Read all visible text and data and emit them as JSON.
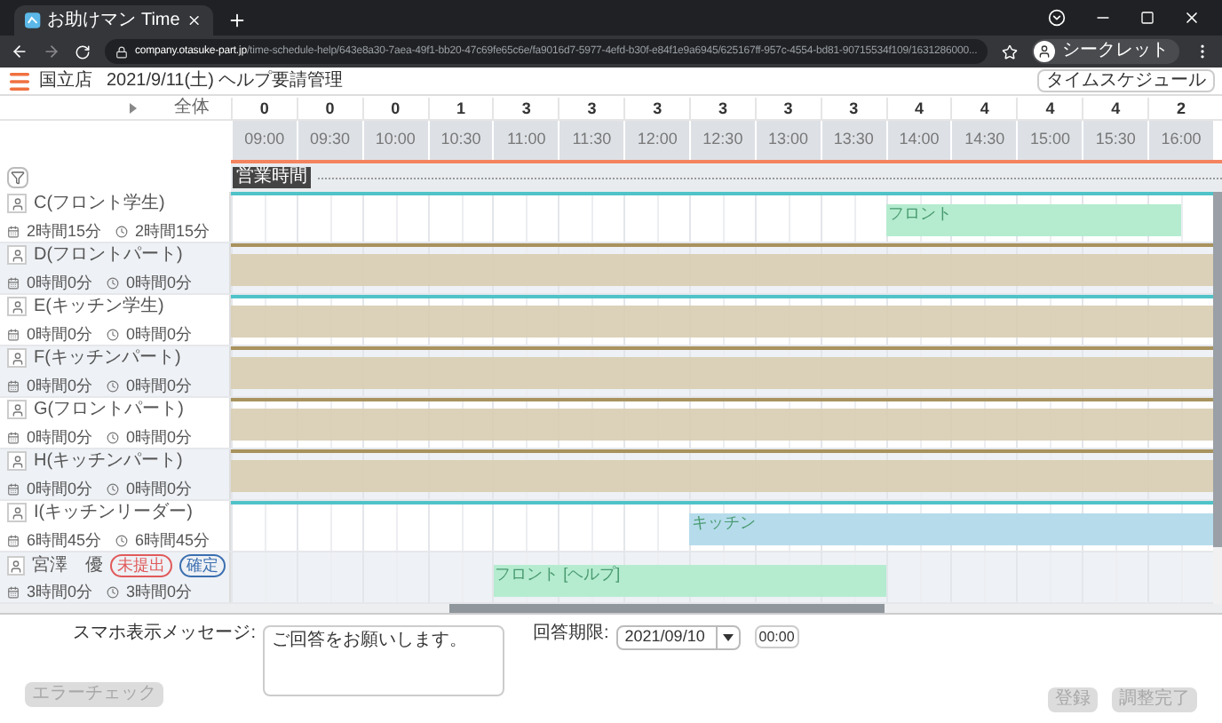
{
  "browser": {
    "tab_title": "お助けマン Time",
    "url_domain": "company.otasuke-part.jp",
    "url_path": "/time-schedule-help/643e8a30-7aea-49f1-bb20-47c69fe65c6e/fa9016d7-5977-4efd-b30f-e84f1e9a6945/625167ff-957c-4554-bd81-90715534f109/1631286000...",
    "profile": "シークレット"
  },
  "header": {
    "store": "国立店",
    "title": "2021/9/11(土) ヘルプ要請管理",
    "button": "タイムスケジュール"
  },
  "schedule": {
    "total_label": "全体",
    "business_hours_label": "営業時間",
    "slots": [
      {
        "time": "09:00",
        "count": "0"
      },
      {
        "time": "09:30",
        "count": "0"
      },
      {
        "time": "10:00",
        "count": "0"
      },
      {
        "time": "10:30",
        "count": "1"
      },
      {
        "time": "11:00",
        "count": "3"
      },
      {
        "time": "11:30",
        "count": "3"
      },
      {
        "time": "12:00",
        "count": "3"
      },
      {
        "time": "12:30",
        "count": "3"
      },
      {
        "time": "13:00",
        "count": "3"
      },
      {
        "time": "13:30",
        "count": "3"
      },
      {
        "time": "14:00",
        "count": "4"
      },
      {
        "time": "14:30",
        "count": "4"
      },
      {
        "time": "15:00",
        "count": "4"
      },
      {
        "time": "15:30",
        "count": "4"
      },
      {
        "time": "16:00",
        "count": "2"
      }
    ],
    "rows": [
      {
        "name": "C(フロント学生)",
        "color": "#4fc3c8",
        "shaded": false,
        "hours": [
          "2時間15分",
          "2時間15分"
        ],
        "shifts": [
          {
            "label": "フロント",
            "color": "#b5ecd0"
          }
        ]
      },
      {
        "name": "D(フロントパート)",
        "color": "#a8925e",
        "shaded": true,
        "hours": [
          "0時間0分",
          "0時間0分"
        ]
      },
      {
        "name": "E(キッチン学生)",
        "color": "#4fc3c8",
        "shaded": true,
        "hours": [
          "0時間0分",
          "0時間0分"
        ]
      },
      {
        "name": "F(キッチンパート)",
        "color": "#a8925e",
        "shaded": true,
        "hours": [
          "0時間0分",
          "0時間0分"
        ]
      },
      {
        "name": "G(フロントパート)",
        "color": "#a8925e",
        "shaded": true,
        "hours": [
          "0時間0分",
          "0時間0分"
        ]
      },
      {
        "name": "H(キッチンパート)",
        "color": "#a8925e",
        "shaded": true,
        "hours": [
          "0時間0分",
          "0時間0分"
        ]
      },
      {
        "name": "I(キッチンリーダー)",
        "color": "#4fc3c8",
        "shaded": false,
        "hours": [
          "6時間45分",
          "6時間45分"
        ],
        "shifts": [
          {
            "label": "キッチン",
            "color": "#b6dcec"
          }
        ]
      },
      {
        "name": "宮澤　優",
        "shaded": false,
        "badges": [
          {
            "label": "未提出",
            "color": "#e05a5a"
          },
          {
            "label": "確定",
            "color": "#3b6fb0"
          }
        ],
        "hours": [
          "3時間0分",
          "3時間0分"
        ],
        "shifts": [
          {
            "label": "フロント [ヘルプ]",
            "color": "#b5ecd0"
          }
        ]
      }
    ]
  },
  "form": {
    "message_label": "スマホ表示メッセージ:",
    "message": "ご回答をお願いします。",
    "deadline_label": "回答期限:",
    "deadline_date": "2021/09/10",
    "deadline_time": "00:00",
    "buttons": [
      {
        "label": "エラーチェック",
        "disabled": true
      },
      {
        "label": "登録",
        "disabled": true
      },
      {
        "label": "調整完了",
        "disabled": true
      }
    ]
  }
}
